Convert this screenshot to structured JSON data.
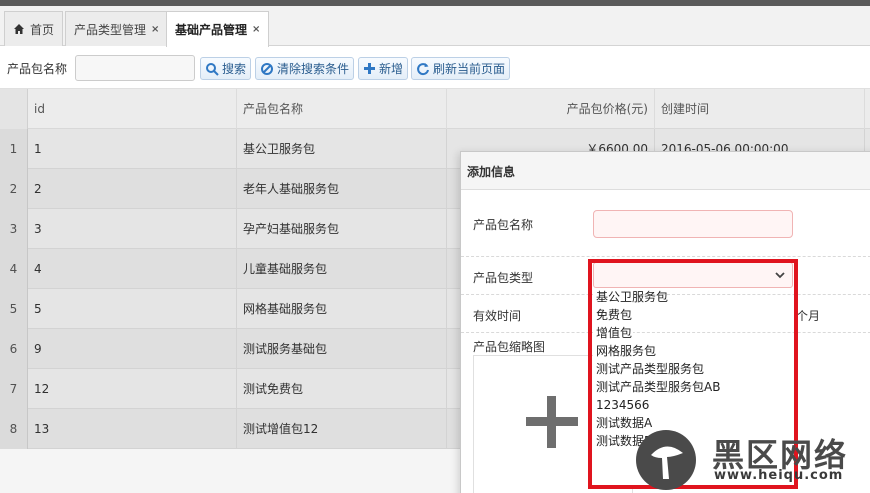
{
  "tabs": [
    {
      "label": "首页",
      "icon": "home-icon",
      "closable": false
    },
    {
      "label": "产品类型管理",
      "closable": true
    },
    {
      "label": "基础产品管理",
      "closable": true,
      "active": true
    }
  ],
  "tab_close_glyph": "×",
  "toolbar": {
    "search_label": "产品包名称",
    "search_value": "",
    "buttons": [
      {
        "label": "搜索",
        "icon": "search-icon"
      },
      {
        "label": "清除搜索条件",
        "icon": "ban-icon"
      },
      {
        "label": "新增",
        "icon": "plus-icon"
      },
      {
        "label": "刷新当前页面",
        "icon": "refresh-icon"
      }
    ]
  },
  "grid": {
    "columns": [
      "id",
      "产品包名称",
      "产品包价格(元)",
      "创建时间"
    ],
    "rows": [
      {
        "num": "1",
        "id": "1",
        "name": "基公卫服务包",
        "price": "￥6600.00",
        "created": "2016-05-06 00:00:00"
      },
      {
        "num": "2",
        "id": "2",
        "name": "老年人基础服务包",
        "price": "",
        "created": ""
      },
      {
        "num": "3",
        "id": "3",
        "name": "孕产妇基础服务包",
        "price": "",
        "created": ""
      },
      {
        "num": "4",
        "id": "4",
        "name": "儿童基础服务包",
        "price": "",
        "created": ""
      },
      {
        "num": "5",
        "id": "5",
        "name": "网格基础服务包",
        "price": "",
        "created": ""
      },
      {
        "num": "6",
        "id": "9",
        "name": "测试服务基础包",
        "price": "",
        "created": ""
      },
      {
        "num": "7",
        "id": "12",
        "name": "测试免费包",
        "price": "",
        "created": ""
      },
      {
        "num": "8",
        "id": "13",
        "name": "测试增值包12",
        "price": "",
        "created": ""
      }
    ]
  },
  "dialog": {
    "title": "添加信息",
    "fields": {
      "name_label": "产品包名称",
      "type_label": "产品包类型",
      "valid_label": "有效时间",
      "valid_unit": "个月",
      "thumb_label": "产品包缩略图"
    },
    "type_options": [
      "基公卫服务包",
      "免费包",
      "增值包",
      "网格服务包",
      "测试产品类型服务包",
      "测试产品类型服务包AB",
      "1234566",
      "测试数据A",
      "测试数据B"
    ]
  },
  "watermark": {
    "text": "黑区网络",
    "url": "www.heiqu.com"
  },
  "colors": {
    "highlight_frame": "#e0141e",
    "link_blue": "#2a5d8f"
  }
}
